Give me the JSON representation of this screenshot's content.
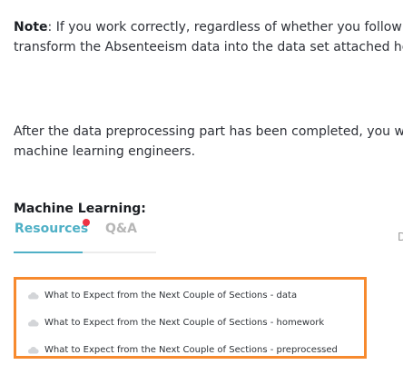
{
  "content": {
    "note_label": "Note",
    "note_line1": ": If you work correctly, regardless of whether you follow th",
    "note_line2": "transform the Absenteeism data into the data set attached here",
    "after_line1": "After the data preprocessing part has been completed, you will",
    "after_line2": "machine learning engineers."
  },
  "course": {
    "title": "Machine Learning:"
  },
  "tabs": [
    {
      "label": "Resources",
      "active": true,
      "notification": true
    },
    {
      "label": "Q&A",
      "active": false
    }
  ],
  "right_fragment": "D",
  "resources": [
    {
      "label": "What to Expect from the Next Couple of Sections - data",
      "icon": "cloud-download-icon"
    },
    {
      "label": "What to Expect from the Next Couple of Sections - homework",
      "icon": "cloud-download-icon"
    },
    {
      "label": "What to Expect from the Next Couple of Sections - preprocessed",
      "icon": "cloud-download-icon"
    }
  ],
  "colors": {
    "accent": "#4fb0c6",
    "highlight_border": "#f78a2e",
    "notification": "#ee3344",
    "inactive_tab": "#b6b6b6"
  }
}
